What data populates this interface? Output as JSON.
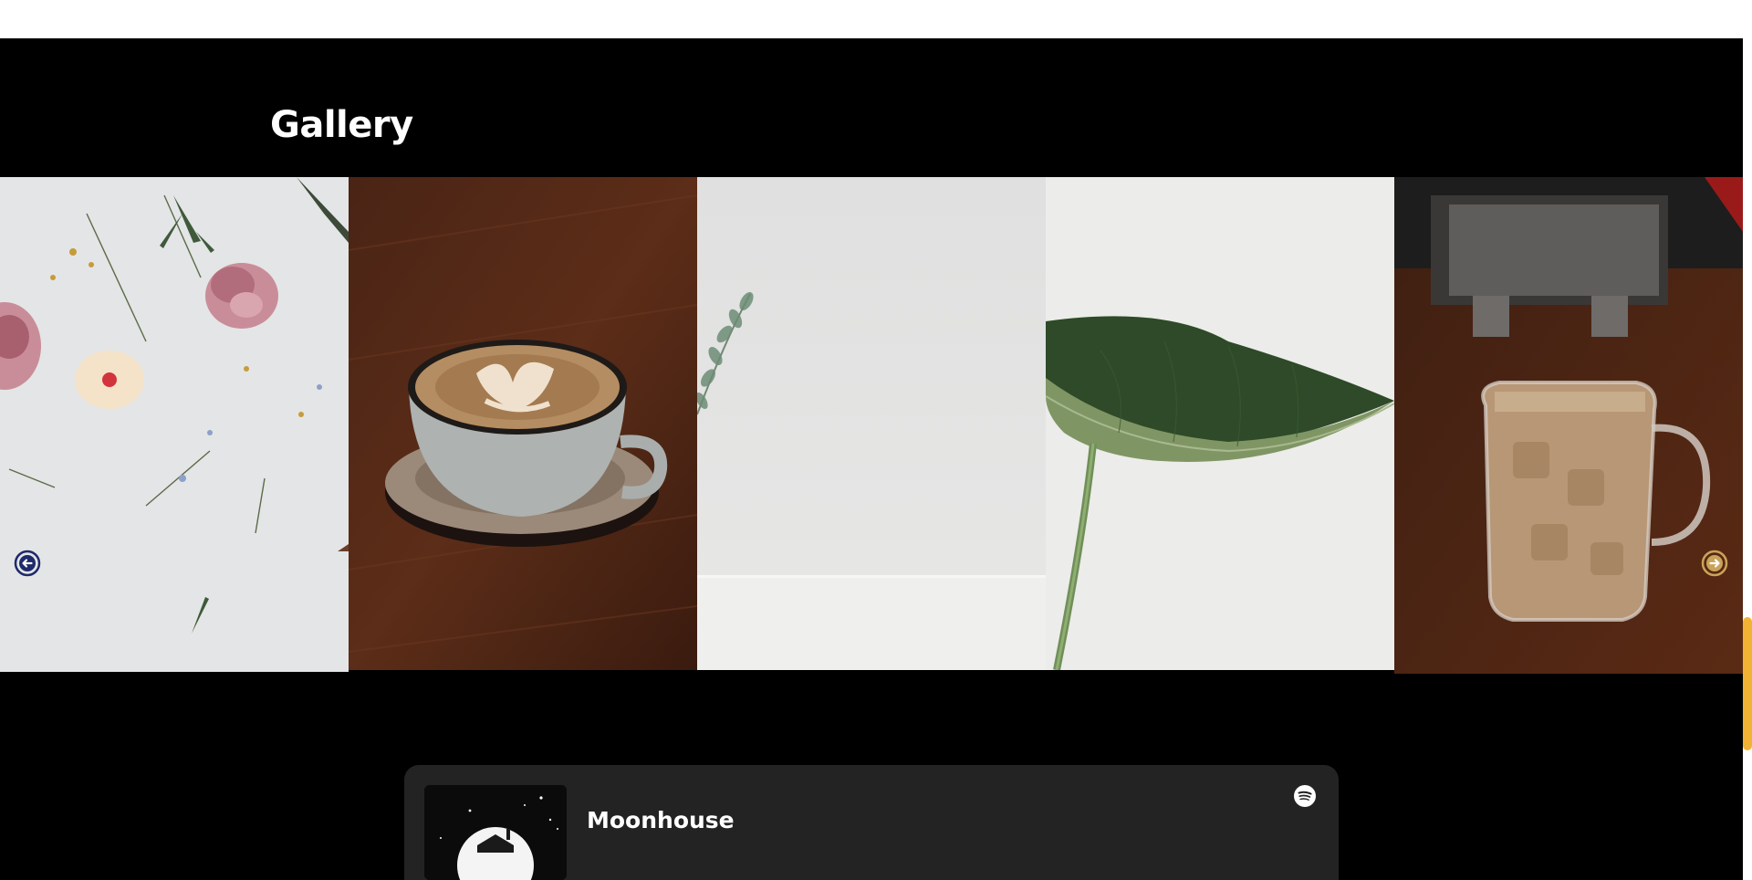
{
  "gallery": {
    "title": "Gallery",
    "images": [
      {
        "name": "pressed-flowers-photo"
      },
      {
        "name": "latte-art-cup-photo"
      },
      {
        "name": "eucalyptus-sprig-photo"
      },
      {
        "name": "green-leaf-photo"
      },
      {
        "name": "iced-coffee-mug-photo"
      }
    ],
    "prev_icon": "arrow-left-icon",
    "next_icon": "arrow-right-icon",
    "prev_arrow_color": "#1f2a6b",
    "next_arrow_color": "#c9a35a"
  },
  "player": {
    "track_title": "Moonhouse",
    "service_icon": "spotify-icon"
  },
  "colors": {
    "section_background": "#000000",
    "player_background": "#232323",
    "scrollbar_thumb": "#f2b233"
  }
}
